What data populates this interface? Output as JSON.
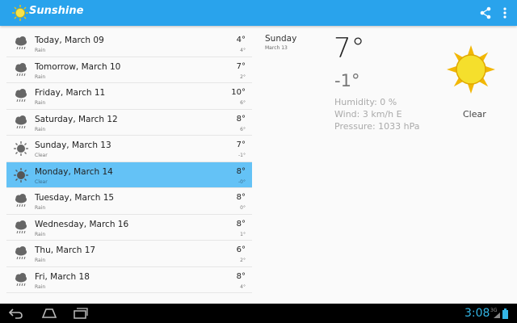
{
  "app": {
    "title": "Sunshine"
  },
  "toolbar": {
    "share_icon": "share-icon",
    "overflow_icon": "overflow-menu-icon"
  },
  "forecast": [
    {
      "date": "Today, March 09",
      "desc": "Rain",
      "high": "4°",
      "low": "4°",
      "icon": "rain-icon"
    },
    {
      "date": "Tomorrow, March 10",
      "desc": "Rain",
      "high": "7°",
      "low": "2°",
      "icon": "rain-icon"
    },
    {
      "date": "Friday, March 11",
      "desc": "Rain",
      "high": "10°",
      "low": "6°",
      "icon": "rain-icon"
    },
    {
      "date": "Saturday, March 12",
      "desc": "Rain",
      "high": "8°",
      "low": "6°",
      "icon": "rain-icon"
    },
    {
      "date": "Sunday, March 13",
      "desc": "Clear",
      "high": "7°",
      "low": "-1°",
      "icon": "sun-icon"
    },
    {
      "date": "Monday, March 14",
      "desc": "Clear",
      "high": "8°",
      "low": "-0°",
      "icon": "sun-icon",
      "selected": true
    },
    {
      "date": "Tuesday, March 15",
      "desc": "Rain",
      "high": "8°",
      "low": "0°",
      "icon": "rain-icon"
    },
    {
      "date": "Wednesday, March 16",
      "desc": "Rain",
      "high": "8°",
      "low": "1°",
      "icon": "rain-icon"
    },
    {
      "date": "Thu, March 17",
      "desc": "Rain",
      "high": "6°",
      "low": "2°",
      "icon": "rain-icon"
    },
    {
      "date": "Fri, March 18",
      "desc": "Rain",
      "high": "8°",
      "low": "4°",
      "icon": "rain-icon"
    }
  ],
  "detail": {
    "day": "Sunday",
    "date": "March 13",
    "high": "7°",
    "low": "-1°",
    "humidity": "Humidity: 0 %",
    "wind": "Wind: 3 km/h E",
    "pressure": "Pressure: 1033 hPa",
    "condition": "Clear",
    "icon": "sun-icon"
  },
  "status": {
    "time": "3:08",
    "signal": "3G"
  },
  "colors": {
    "accent": "#29a3ec",
    "selected_row": "#64c2f6",
    "clock": "#33b5e5"
  }
}
